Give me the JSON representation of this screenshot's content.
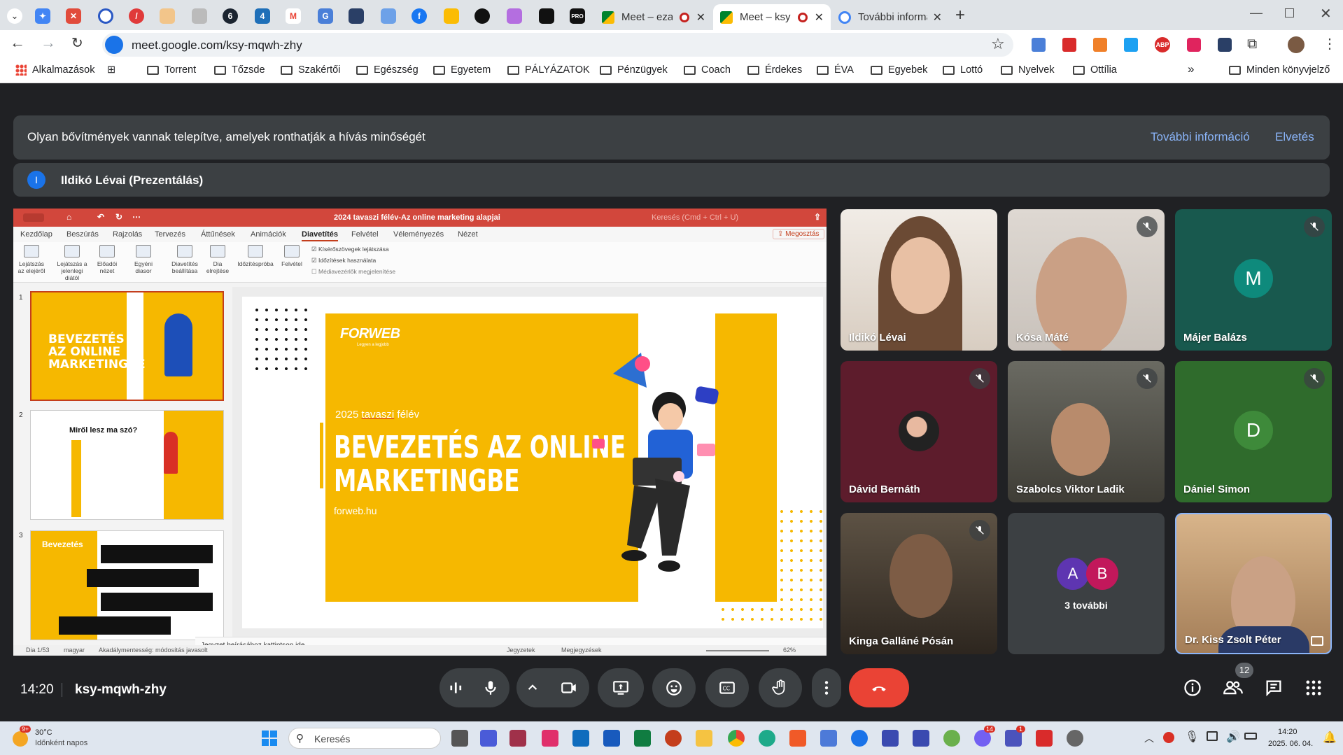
{
  "browser": {
    "tabs": [
      {
        "title": "Meet – eza-bq"
      },
      {
        "title": "Meet – ksy-mq"
      },
      {
        "title": "További információ"
      }
    ],
    "url": "meet.google.com/ksy-mqwh-zhy",
    "bookmarks": [
      "Alkalmazások",
      "Torrent",
      "Tőzsde",
      "Szakértői",
      "Egészség",
      "Egyetem",
      "PÁLYÁZATOK",
      "Pénzügyek",
      "Coach",
      "Érdekes",
      "ÉVA",
      "Egyebek",
      "Lottó",
      "Nyelvek",
      "Ottília",
      "Minden könyvjelző"
    ],
    "more_bookmarks": "»"
  },
  "meet": {
    "banner_text": "Olyan bővítmények vannak telepítve, amelyek ronthatják a hívás minőségét",
    "banner_more": "További információ",
    "banner_dismiss": "Elvetés",
    "presenter_initial": "I",
    "presenter_label": "Ildikó Lévai (Prezentálás)",
    "participants": [
      {
        "name": "Ildikó Lévai"
      },
      {
        "name": "Kósa Máté"
      },
      {
        "name": "Májer Balázs",
        "initial": "M"
      },
      {
        "name": "Dávid Bernáth"
      },
      {
        "name": "Szabolcs Viktor Ladik"
      },
      {
        "name": "Dániel Simon",
        "initial": "D"
      },
      {
        "name": "Kinga Galláné Pósán"
      },
      {
        "name": "3 további",
        "initials": [
          "A",
          "B"
        ]
      },
      {
        "name": "Dr. Kiss Zsolt Péter"
      }
    ],
    "time": "14:20",
    "meeting_code": "ksy-mqwh-zhy",
    "participant_count": "12"
  },
  "ppt": {
    "title": "2024 tavaszi félév-Az online marketing alapjai",
    "search_placeholder": "Keresés (Cmd + Ctrl + U)",
    "tabs": [
      "Kezdőlap",
      "Beszúrás",
      "Rajzolás",
      "Tervezés",
      "Áttűnések",
      "Animációk",
      "Diavetítés",
      "Felvétel",
      "Véleményezés",
      "Nézet"
    ],
    "share": "Megosztás",
    "ribbon": [
      "Lejátszás az elejéről",
      "Lejátszás a jelenlegi diától",
      "Előadói nézet",
      "Egyéni diasor",
      "Diavetítés beállítása",
      "Dia elrejtése",
      "Időzítéspróba",
      "Felvétel"
    ],
    "checks": [
      "Kísérőszövegek lejátszása",
      "Időzítések használata",
      "Médiavezérlők megjelenítése"
    ],
    "slide_numbers": [
      "1",
      "2",
      "3"
    ],
    "thumb1_title": "BEVEZETÉS AZ ONLINE MARKETINGBE",
    "thumb2_title": "Miről lesz ma szó?",
    "thumb3_title": "Bevezetés",
    "slide": {
      "logo": "FORWEB",
      "logo_sub": "Legyen a legjobb",
      "subtitle_a": "2025",
      "subtitle_b": "tavaszi",
      "subtitle_c": "félév",
      "title_line1": "BEVEZETÉS AZ ONLINE",
      "title_line2": "MARKETINGBE",
      "website": "forweb.hu"
    },
    "notes_placeholder": "Jegyzet beírásához kattintson ide",
    "status_slide": "Dia 1/53",
    "status_lang": "magyar",
    "status_access": "Akadálymentesség: módosítás javasolt",
    "status_notes": "Jegyzetek",
    "status_comments": "Megjegyzések",
    "zoom": "62%"
  },
  "taskbar": {
    "temp": "30°C",
    "weather": "Időnként napos",
    "weather_badge": "9+",
    "search_placeholder": "Keresés",
    "time": "14:20",
    "date": "2025. 06. 04.",
    "badge_viber": "14",
    "badge_teams": "1"
  }
}
